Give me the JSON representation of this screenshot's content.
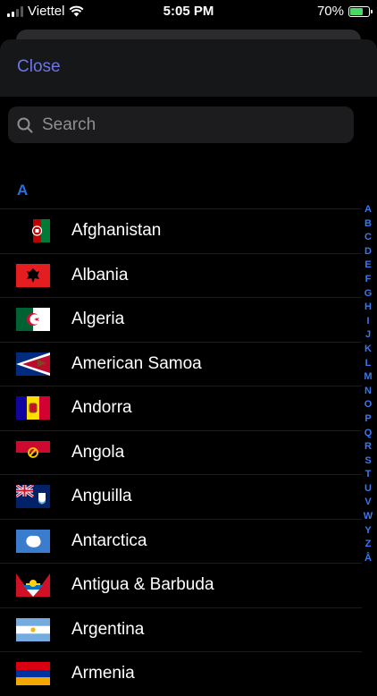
{
  "status_bar": {
    "carrier": "Viettel",
    "time": "5:05 PM",
    "battery": "70%",
    "battery_level": 0.7
  },
  "header": {
    "close_label": "Close"
  },
  "search": {
    "placeholder": "Search"
  },
  "section": {
    "title": "A"
  },
  "countries": [
    {
      "name": "Afghanistan",
      "flag": "afghanistan-flag"
    },
    {
      "name": "Albania",
      "flag": "albania-flag"
    },
    {
      "name": "Algeria",
      "flag": "algeria-flag"
    },
    {
      "name": "American Samoa",
      "flag": "american-samoa-flag"
    },
    {
      "name": "Andorra",
      "flag": "andorra-flag"
    },
    {
      "name": "Angola",
      "flag": "angola-flag"
    },
    {
      "name": "Anguilla",
      "flag": "anguilla-flag"
    },
    {
      "name": "Antarctica",
      "flag": "antarctica-flag"
    },
    {
      "name": "Antigua & Barbuda",
      "flag": "antigua-barbuda-flag"
    },
    {
      "name": "Argentina",
      "flag": "argentina-flag"
    },
    {
      "name": "Armenia",
      "flag": "armenia-flag"
    }
  ],
  "index_letters": [
    "A",
    "B",
    "C",
    "D",
    "E",
    "F",
    "G",
    "H",
    "I",
    "J",
    "K",
    "L",
    "M",
    "N",
    "O",
    "P",
    "Q",
    "R",
    "S",
    "T",
    "U",
    "V",
    "W",
    "Y",
    "Z",
    "Å"
  ],
  "colors": {
    "accent": "#6f74e8",
    "index": "#3b78ee",
    "section": "#2a6fe0",
    "background": "#000000"
  }
}
